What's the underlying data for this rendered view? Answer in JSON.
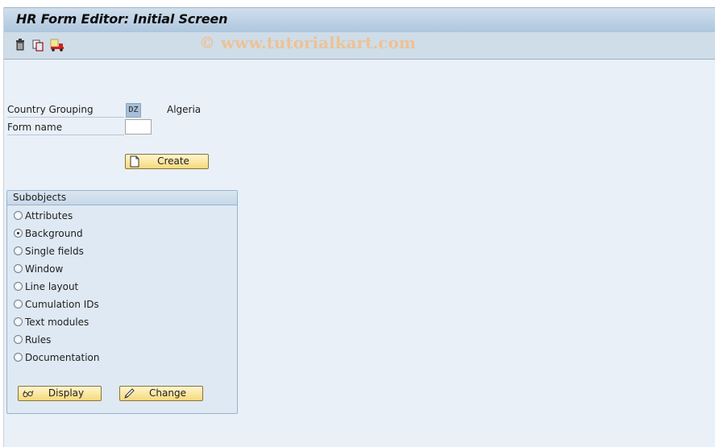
{
  "window": {
    "title": "HR Form Editor: Initial Screen",
    "watermark": "© www.tutorialkart.com"
  },
  "toolbar": {
    "icons": [
      {
        "name": "delete-icon",
        "glyph": "trash"
      },
      {
        "name": "copy-icon",
        "glyph": "copy"
      },
      {
        "name": "transport-icon",
        "glyph": "truck"
      }
    ]
  },
  "fields": {
    "country_grouping": {
      "label": "Country Grouping",
      "value": "DZ",
      "description": "Algeria"
    },
    "form_name": {
      "label": "Form name",
      "value": "",
      "placeholder": ""
    }
  },
  "buttons": {
    "create": "Create",
    "display": "Display",
    "change": "Change"
  },
  "subobjects": {
    "title": "Subobjects",
    "selected": "Background",
    "options": [
      {
        "label": "Attributes",
        "checked": false
      },
      {
        "label": "Background",
        "checked": true
      },
      {
        "label": "Single fields",
        "checked": false
      },
      {
        "label": "Window",
        "checked": false
      },
      {
        "label": "Line layout",
        "checked": false
      },
      {
        "label": "Cumulation IDs",
        "checked": false
      },
      {
        "label": "Text modules",
        "checked": false
      },
      {
        "label": "Rules",
        "checked": false
      },
      {
        "label": "Documentation",
        "checked": false
      }
    ]
  }
}
